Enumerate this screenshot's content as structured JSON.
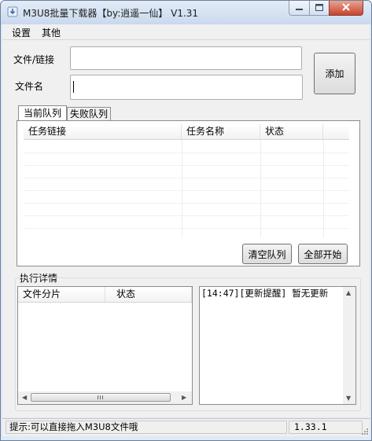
{
  "window": {
    "title": "M3U8批量下载器【by:逍遥一仙】 V1.31"
  },
  "menu": {
    "items": [
      "设置",
      "其他"
    ]
  },
  "form": {
    "file_link_label": "文件/链接",
    "file_link_value": "",
    "file_name_label": "文件名",
    "file_name_value": "",
    "add_button": "添加"
  },
  "queue": {
    "tabs": [
      "当前队列",
      "失败队列"
    ],
    "columns": [
      "任务链接",
      "任务名称",
      "状态"
    ],
    "rows": [],
    "clear_button": "清空队列",
    "start_all_button": "全部开始"
  },
  "details": {
    "group_label": "执行详情",
    "columns": [
      "文件分片",
      "状态"
    ],
    "log": "[14:47][更新提醒] 暂无更新"
  },
  "status": {
    "hint": "提示:可以直接拖入M3U8文件哦",
    "version": "1.33.1"
  }
}
